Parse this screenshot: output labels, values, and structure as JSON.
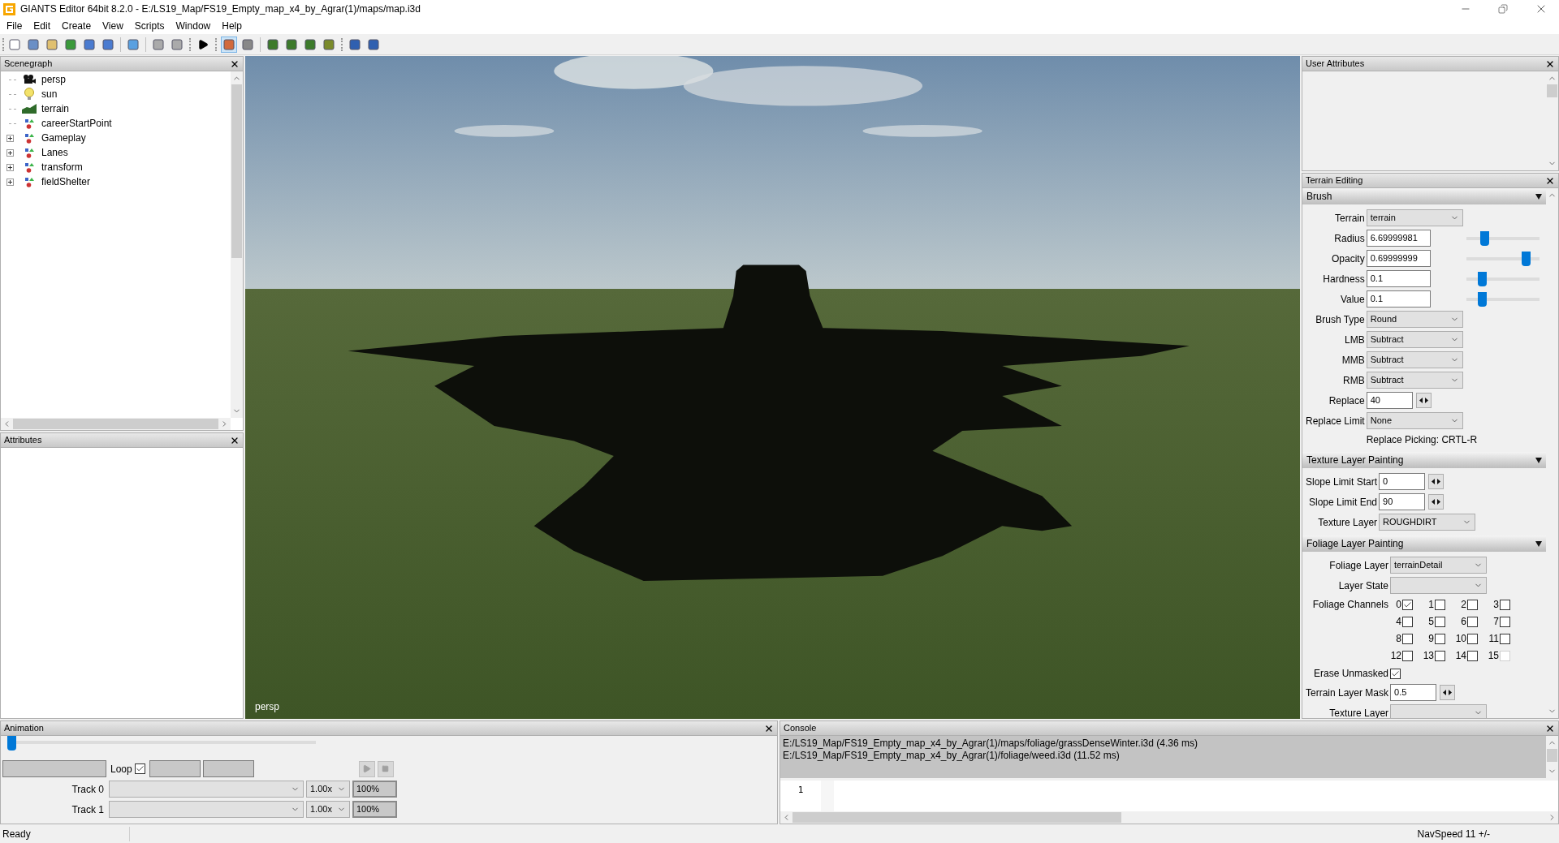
{
  "window": {
    "title": "GIANTS Editor 64bit 8.2.0 - E:/LS19_Map/FS19_Empty_map_x4_by_Agrar(1)/maps/map.i3d"
  },
  "menu": [
    "File",
    "Edit",
    "Create",
    "View",
    "Scripts",
    "Window",
    "Help"
  ],
  "toolbar": {
    "home_selected": true
  },
  "scenegraph": {
    "title": "Scenegraph",
    "items": [
      {
        "label": "persp",
        "kind": "camera",
        "collapsed": false
      },
      {
        "label": "sun",
        "kind": "light",
        "collapsed": false
      },
      {
        "label": "terrain",
        "kind": "terrain",
        "collapsed": false
      },
      {
        "label": "careerStartPoint",
        "kind": "transform",
        "collapsed": false
      },
      {
        "label": "Gameplay",
        "kind": "transform",
        "collapsed": true
      },
      {
        "label": "Lanes",
        "kind": "transform",
        "collapsed": true
      },
      {
        "label": "transform",
        "kind": "transform",
        "collapsed": true
      },
      {
        "label": "fieldShelter",
        "kind": "transform",
        "collapsed": true
      }
    ]
  },
  "attributes": {
    "title": "Attributes"
  },
  "viewport": {
    "camera_label": "persp"
  },
  "user_attributes": {
    "title": "User Attributes"
  },
  "terrain_editing": {
    "title": "Terrain Editing",
    "sections": [
      {
        "title": "Brush",
        "expanded": true,
        "rows": [
          {
            "kind": "select",
            "label": "Terrain",
            "value": "terrain"
          },
          {
            "kind": "slider",
            "label": "Radius",
            "value": "6.69999981",
            "level": 0.22
          },
          {
            "kind": "slider",
            "label": "Opacity",
            "value": "0.69999999",
            "level": 0.86
          },
          {
            "kind": "slider",
            "label": "Hardness",
            "value": "0.1",
            "level": 0.18
          },
          {
            "kind": "slider",
            "label": "Value",
            "value": "0.1",
            "level": 0.18
          },
          {
            "kind": "select",
            "label": "Brush Type",
            "value": "Round"
          },
          {
            "kind": "select",
            "label": "LMB",
            "value": "Subtract"
          },
          {
            "kind": "select",
            "label": "MMB",
            "value": "Subtract"
          },
          {
            "kind": "select",
            "label": "RMB",
            "value": "Subtract"
          },
          {
            "kind": "spin",
            "label": "Replace",
            "value": "40"
          },
          {
            "kind": "select",
            "label": "Replace Limit",
            "value": "None"
          },
          {
            "kind": "note",
            "text": "Replace Picking: CRTL-R"
          }
        ]
      },
      {
        "title": "Texture Layer Painting",
        "expanded": true,
        "rows": [
          {
            "kind": "spin",
            "label": "Slope Limit Start",
            "value": "0"
          },
          {
            "kind": "spin",
            "label": "Slope Limit End",
            "value": "90"
          },
          {
            "kind": "select",
            "label": "Texture Layer",
            "value": "ROUGHDIRT"
          }
        ]
      },
      {
        "title": "Foliage Layer Painting",
        "expanded": true,
        "rows": [
          {
            "kind": "select",
            "label": "Foliage Layer",
            "value": "terrainDetail"
          },
          {
            "kind": "select",
            "label": "Layer State"
          },
          {
            "kind": "channels",
            "label": "Foliage Channels",
            "channels": [
              {
                "label": "0",
                "checked": true,
                "disabled": false
              },
              {
                "label": "1",
                "checked": false,
                "disabled": false
              },
              {
                "label": "2",
                "checked": false,
                "disabled": false
              },
              {
                "label": "3",
                "checked": false,
                "disabled": false
              },
              {
                "label": "4",
                "checked": false,
                "disabled": false
              },
              {
                "label": "5",
                "checked": false,
                "disabled": false
              },
              {
                "label": "6",
                "checked": false,
                "disabled": false
              },
              {
                "label": "7",
                "checked": false,
                "disabled": false
              },
              {
                "label": "8",
                "checked": false,
                "disabled": false
              },
              {
                "label": "9",
                "checked": false,
                "disabled": false
              },
              {
                "label": "10",
                "checked": false,
                "disabled": false
              },
              {
                "label": "11",
                "checked": false,
                "disabled": false
              },
              {
                "label": "12",
                "checked": false,
                "disabled": false
              },
              {
                "label": "13",
                "checked": false,
                "disabled": false
              },
              {
                "label": "14",
                "checked": false,
                "disabled": false
              },
              {
                "label": "15",
                "checked": false,
                "disabled": true
              }
            ]
          },
          {
            "kind": "check",
            "label": "Erase Unmasked",
            "checked": true
          },
          {
            "kind": "spin",
            "label": "Terrain Layer Mask",
            "value": "0.5"
          },
          {
            "kind": "select",
            "label": "Texture Layer"
          }
        ]
      }
    ]
  },
  "animation": {
    "title": "Animation",
    "level": 0,
    "loop_label": "Loop",
    "loop": true,
    "tracks": [
      {
        "label": "Track 0",
        "speed": "1.00x",
        "weight": "100%"
      },
      {
        "label": "Track 1",
        "speed": "1.00x",
        "weight": "100%"
      }
    ]
  },
  "console": {
    "title": "Console",
    "lines": [
      "E:/LS19_Map/FS19_Empty_map_x4_by_Agrar(1)/maps/foliage/grassDenseWinter.i3d (4.36 ms)",
      "E:/LS19_Map/FS19_Empty_map_x4_by_Agrar(1)/foliage/weed.i3d (11.52 ms)"
    ],
    "line_numbers": [
      "1"
    ]
  },
  "status_bar": {
    "message": "Ready",
    "nav_speed": "NavSpeed 11 +/-"
  }
}
